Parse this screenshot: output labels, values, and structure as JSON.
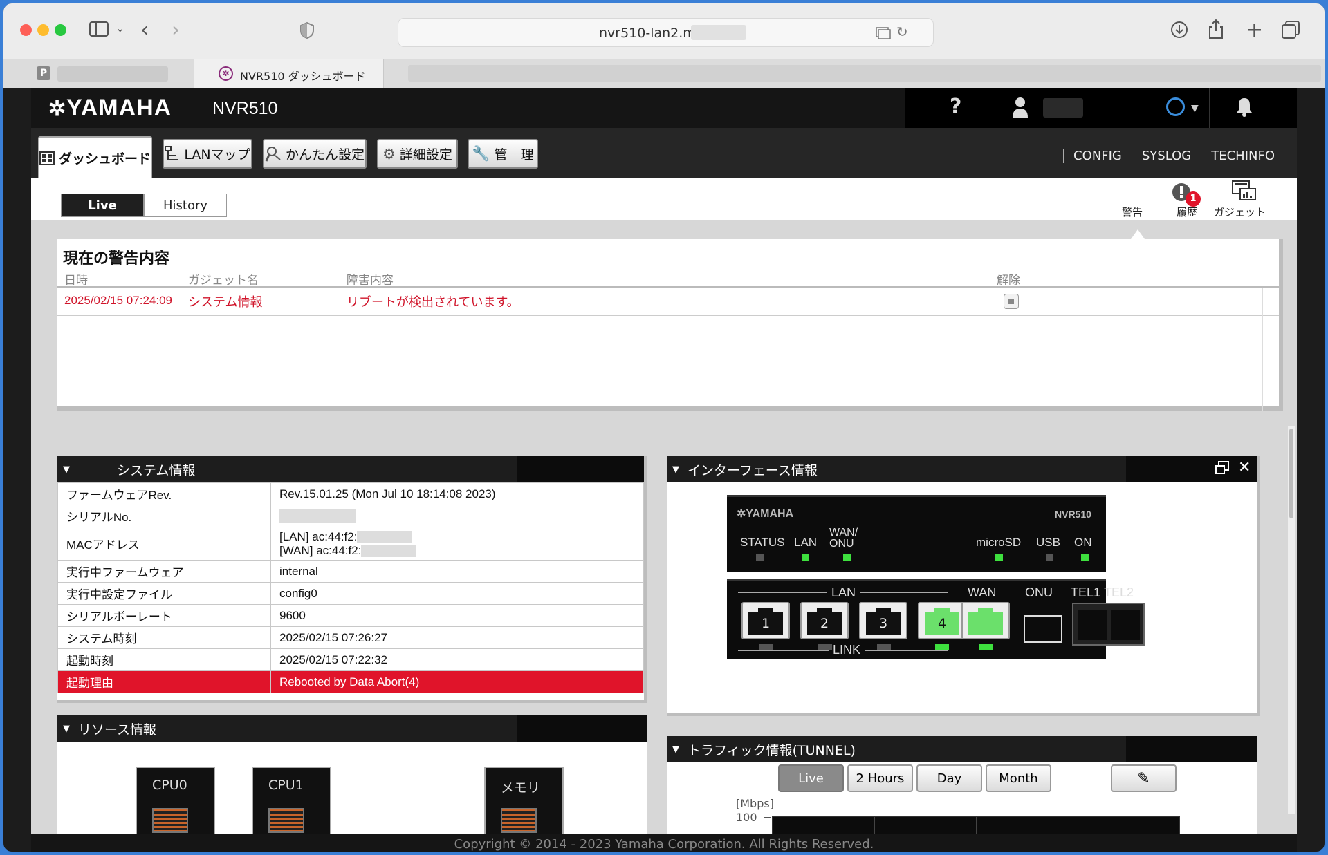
{
  "browser": {
    "url": "nvr510-lan2.m",
    "tab_active_label": "NVR510 ダッシュボード"
  },
  "header": {
    "brand": "YAMAHA",
    "model": "NVR510",
    "help_icon": "?"
  },
  "nav": {
    "tabs": [
      "ダッシュボード",
      "LANマップ",
      "かんたん設定",
      "詳細設定",
      "管　理"
    ],
    "links": [
      "CONFIG",
      "SYSLOG",
      "TECHINFO"
    ]
  },
  "view": {
    "live": "Live",
    "history": "History"
  },
  "toolbar": {
    "alert": "警告",
    "history": "履歴",
    "history_badge": "1",
    "gadget": "ガジェット"
  },
  "alerts": {
    "title": "現在の警告内容",
    "columns": [
      "日時",
      "ガジェット名",
      "障害内容",
      "解除"
    ],
    "rows": [
      {
        "datetime": "2025/02/15 07:24:09",
        "gadget": "システム情報",
        "message": "リブートが検出されています。"
      }
    ]
  },
  "system_info": {
    "title": "システム情報",
    "rows": [
      {
        "label": "ファームウェアRev.",
        "value": "Rev.15.01.25 (Mon Jul 10 18:14:08 2023)"
      },
      {
        "label": "シリアルNo.",
        "value": ""
      },
      {
        "label": "MACアドレス",
        "value": "[LAN] ac:44:f2:",
        "value2": "[WAN] ac:44:f2:"
      },
      {
        "label": "実行中ファームウェア",
        "value": "internal"
      },
      {
        "label": "実行中設定ファイル",
        "value": "config0"
      },
      {
        "label": "シリアルボーレート",
        "value": "9600"
      },
      {
        "label": "システム時刻",
        "value": "2025/02/15 07:26:27"
      },
      {
        "label": "起動時刻",
        "value": "2025/02/15 07:22:32"
      },
      {
        "label": "起動理由",
        "value": "Rebooted by Data Abort(4)"
      }
    ]
  },
  "interface_info": {
    "title": "インターフェース情報",
    "device_brand": "YAMAHA",
    "device_model": "NVR510",
    "leds": [
      "STATUS",
      "LAN",
      "WAN/",
      "ONU",
      "microSD",
      "USB",
      "ON"
    ],
    "lan_label": "LAN",
    "link_label": "LINK",
    "ports": [
      "1",
      "2",
      "3",
      "4"
    ],
    "wan_label": "WAN",
    "onu_label": "ONU",
    "tel1": "TEL1",
    "tel2": "TEL2"
  },
  "resource_info": {
    "title": "リソース情報",
    "boxes": [
      "CPU0",
      "CPU1",
      "メモリ"
    ]
  },
  "traffic_info": {
    "title": "トラフィック情報(TUNNEL)",
    "buttons": [
      "Live",
      "2 Hours",
      "Day",
      "Month"
    ],
    "unit": "[Mbps]",
    "ymax": "100"
  },
  "footer": "Copyright © 2014 - 2023 Yamaha Corporation. All Rights Reserved."
}
